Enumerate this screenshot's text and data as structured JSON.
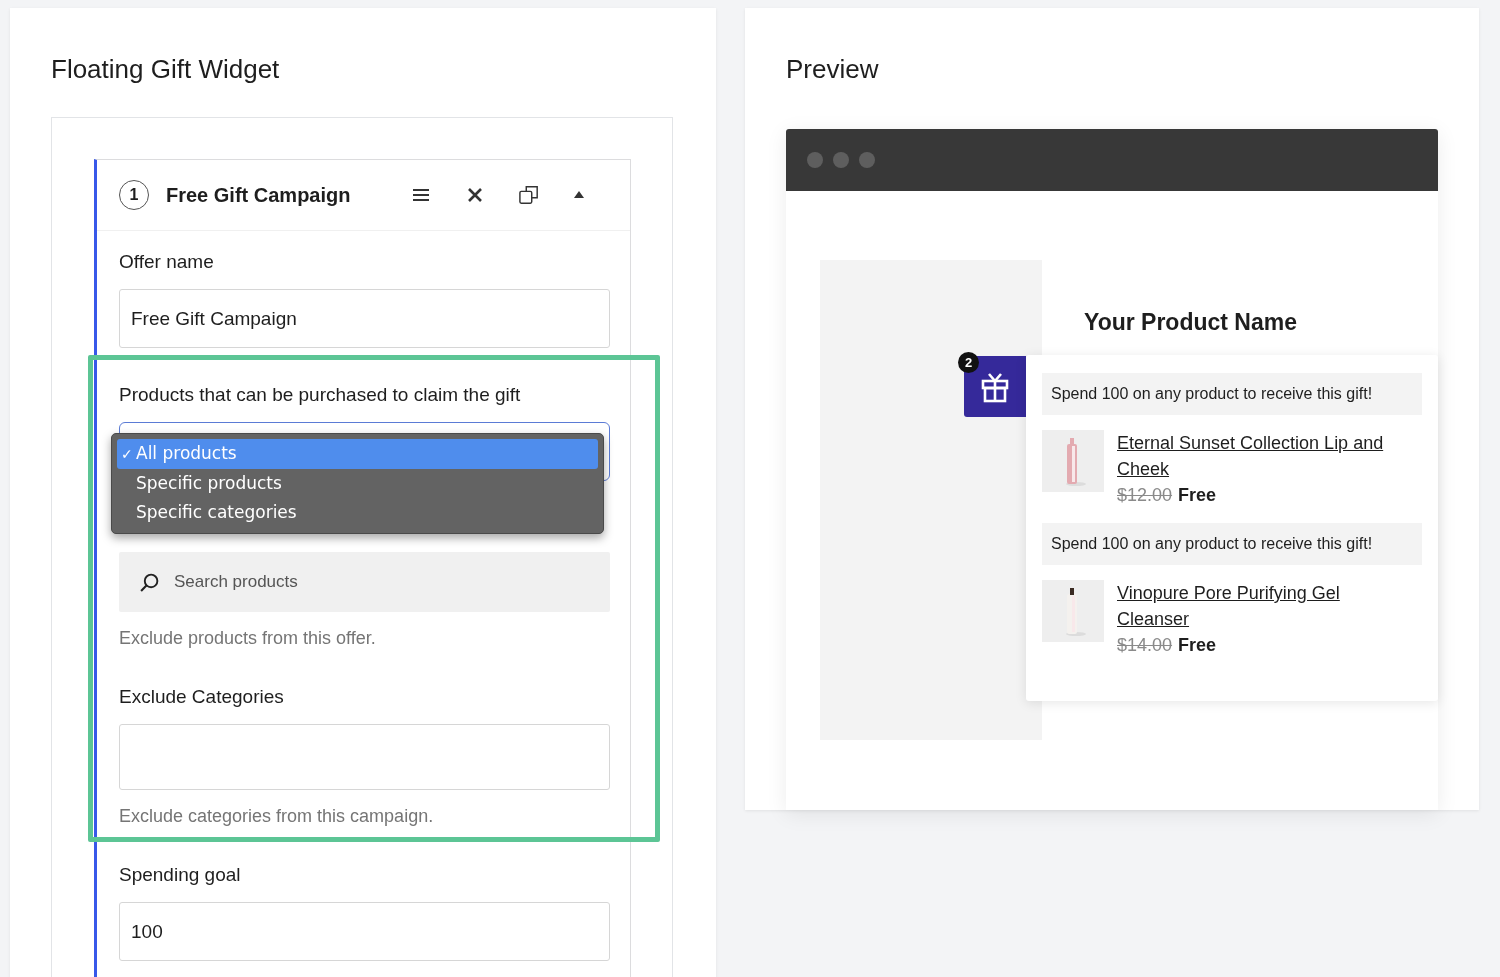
{
  "editor": {
    "title": "Floating Gift Widget",
    "campaign": {
      "number": "1",
      "title": "Free Gift Campaign",
      "expanded": true
    },
    "offer_name": {
      "label": "Offer name",
      "value": "Free Gift Campaign"
    },
    "products": {
      "label": "Products that can be purchased to claim the gift",
      "options": [
        {
          "mark": "✓",
          "label": "All products",
          "selected": true
        },
        {
          "label": "Specific products",
          "selected": false
        },
        {
          "label": "Specific categories",
          "selected": false
        }
      ]
    },
    "exclude_products": {
      "placeholder": "Search products",
      "help": "Exclude products from this offer."
    },
    "exclude_categories": {
      "label": "Exclude Categories",
      "help": "Exclude categories from this campaign."
    },
    "spending_goal": {
      "label": "Spending goal",
      "value": "100"
    }
  },
  "preview": {
    "title": "Preview",
    "product_name": "Your Product Name",
    "gift_badge": "2",
    "offers": [
      {
        "message": "Spend 100 on any product to receive this gift!",
        "product": "Eternal Sunset Collection Lip and Cheek",
        "old_price": "$12.00",
        "price": "Free"
      },
      {
        "message": "Spend 100 on any product to receive this gift!",
        "product": "Vinopure Pore Purifying Gel Cleanser",
        "old_price": "$14.00",
        "price": "Free"
      }
    ]
  }
}
